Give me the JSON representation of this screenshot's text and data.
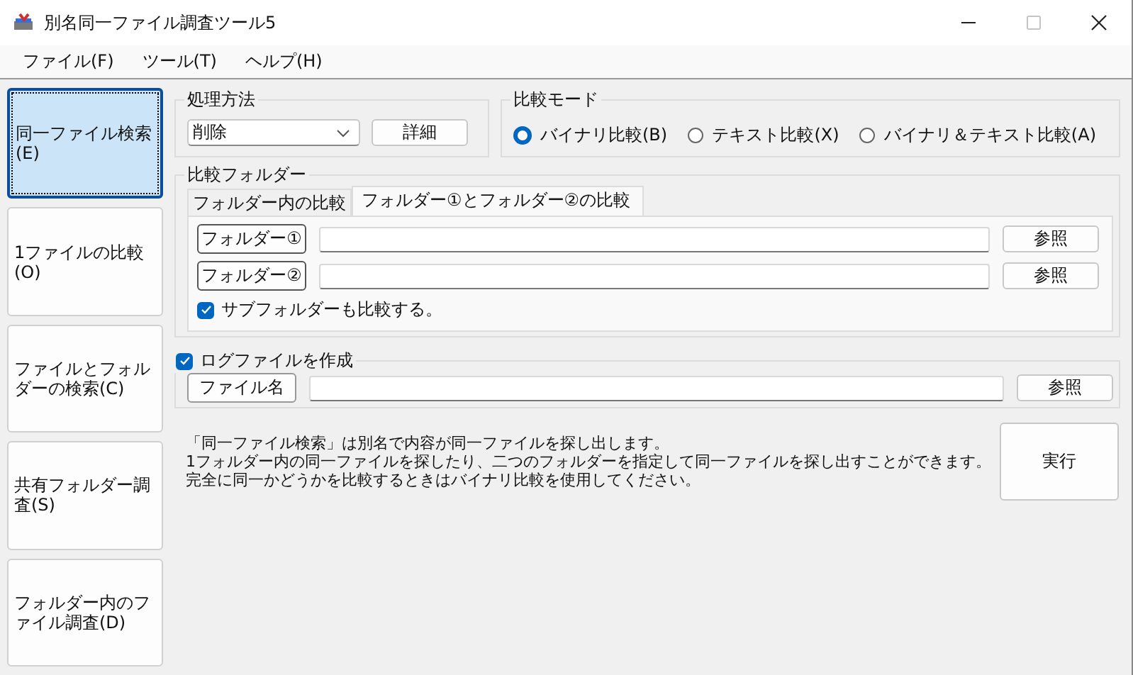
{
  "window": {
    "title": "別名同一ファイル調査ツール5"
  },
  "menu": [
    {
      "label": "ファイル(F)"
    },
    {
      "label": "ツール(T)"
    },
    {
      "label": "ヘルプ(H)"
    }
  ],
  "sidebar": {
    "items": [
      {
        "label": "同一ファイル検索(E)",
        "selected": true
      },
      {
        "label": "1ファイルの比較(O)",
        "selected": false
      },
      {
        "label": "ファイルとフォルダーの検索(C)",
        "selected": false
      },
      {
        "label": "共有フォルダー調査(S)",
        "selected": false
      },
      {
        "label": "フォルダー内のファイル調査(D)",
        "selected": false
      }
    ]
  },
  "processing": {
    "legend": "処理方法",
    "method": "削除",
    "detail_button": "詳細"
  },
  "compare_mode": {
    "legend": "比較モード",
    "options": [
      {
        "label": "バイナリ比較(B)",
        "selected": true
      },
      {
        "label": "テキスト比較(X)",
        "selected": false
      },
      {
        "label": "バイナリ＆テキスト比較(A)",
        "selected": false
      }
    ]
  },
  "compare_folder": {
    "legend": "比較フォルダー",
    "tabs": [
      {
        "label": "フォルダー内の比較",
        "selected": false
      },
      {
        "label": "フォルダー①とフォルダー②の比較",
        "selected": true
      }
    ],
    "folders": [
      {
        "button": "フォルダー①",
        "browse": "参照"
      },
      {
        "button": "フォルダー②",
        "browse": "参照"
      }
    ],
    "subfolder": {
      "label": "サブフォルダーも比較する。",
      "checked": true
    }
  },
  "log": {
    "label": "ログファイルを作成",
    "checked": true,
    "file_button": "ファイル名",
    "browse": "参照"
  },
  "description": [
    "「同一ファイル検索」は別名で内容が同一ファイルを探し出します。",
    "1フォルダー内の同一ファイルを探したり、二つのフォルダーを指定して同一ファイルを探し出すことができます。",
    "完全に同一かどうかを比較するときはバイナリ比較を使用してください。"
  ],
  "run_button": "実行"
}
